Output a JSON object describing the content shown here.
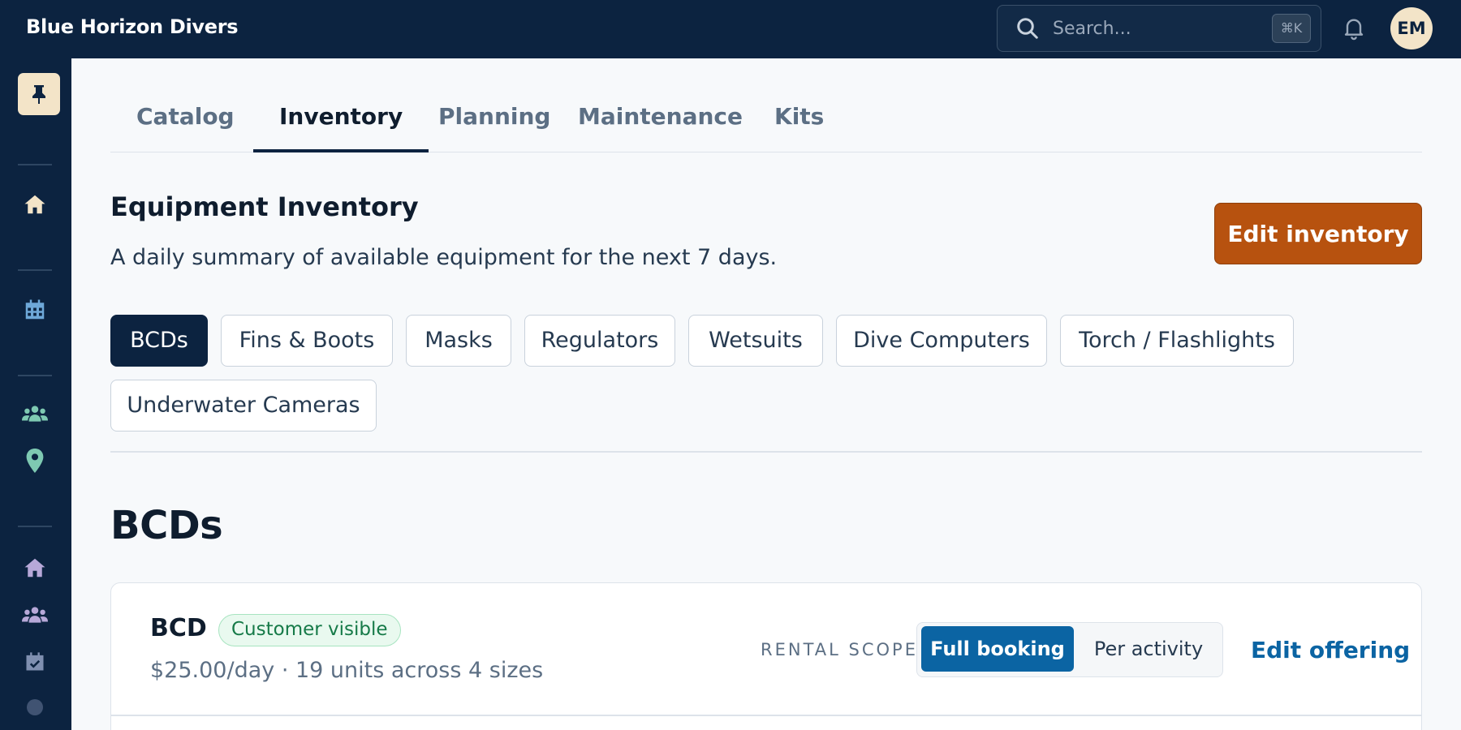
{
  "app": {
    "name": "Blue Horizon Divers"
  },
  "search": {
    "placeholder": "Search...",
    "shortcut": "⌘K"
  },
  "user": {
    "initials": "EM"
  },
  "sidebar": {
    "icons": [
      "pin-icon",
      "home-icon",
      "calendar-icon",
      "team-icon",
      "location-pin-icon",
      "home-icon",
      "team-icon",
      "calendar-check-icon"
    ]
  },
  "tabs": [
    {
      "label": "Catalog",
      "active": false
    },
    {
      "label": "Inventory",
      "active": true
    },
    {
      "label": "Planning",
      "active": false
    },
    {
      "label": "Maintenance",
      "active": false
    },
    {
      "label": "Kits",
      "active": false
    }
  ],
  "header": {
    "title": "Equipment Inventory",
    "subtitle": "A daily summary of available equipment for the next 7 days.",
    "edit_button": "Edit inventory"
  },
  "categories": [
    {
      "label": "BCDs",
      "active": true
    },
    {
      "label": "Fins & Boots",
      "active": false
    },
    {
      "label": "Masks",
      "active": false
    },
    {
      "label": "Regulators",
      "active": false
    },
    {
      "label": "Wetsuits",
      "active": false
    },
    {
      "label": "Dive Computers",
      "active": false
    },
    {
      "label": "Torch / Flashlights",
      "active": false
    },
    {
      "label": "Underwater Cameras",
      "active": false
    }
  ],
  "section": {
    "title": "BCDs"
  },
  "offering": {
    "name": "BCD",
    "badge": "Customer visible",
    "summary": "$25.00/day · 19 units across 4 sizes",
    "scope_label": "RENTAL SCOPE",
    "scope_options": [
      "Full booking",
      "Per activity"
    ],
    "scope_selected": "Full booking",
    "edit_label": "Edit offering"
  },
  "colors": {
    "navy": "#0c2340",
    "accent_orange": "#b7520f",
    "accent_blue": "#0b64a3",
    "success_green": "#167a48",
    "avatar_bg": "#f3e4c8"
  }
}
